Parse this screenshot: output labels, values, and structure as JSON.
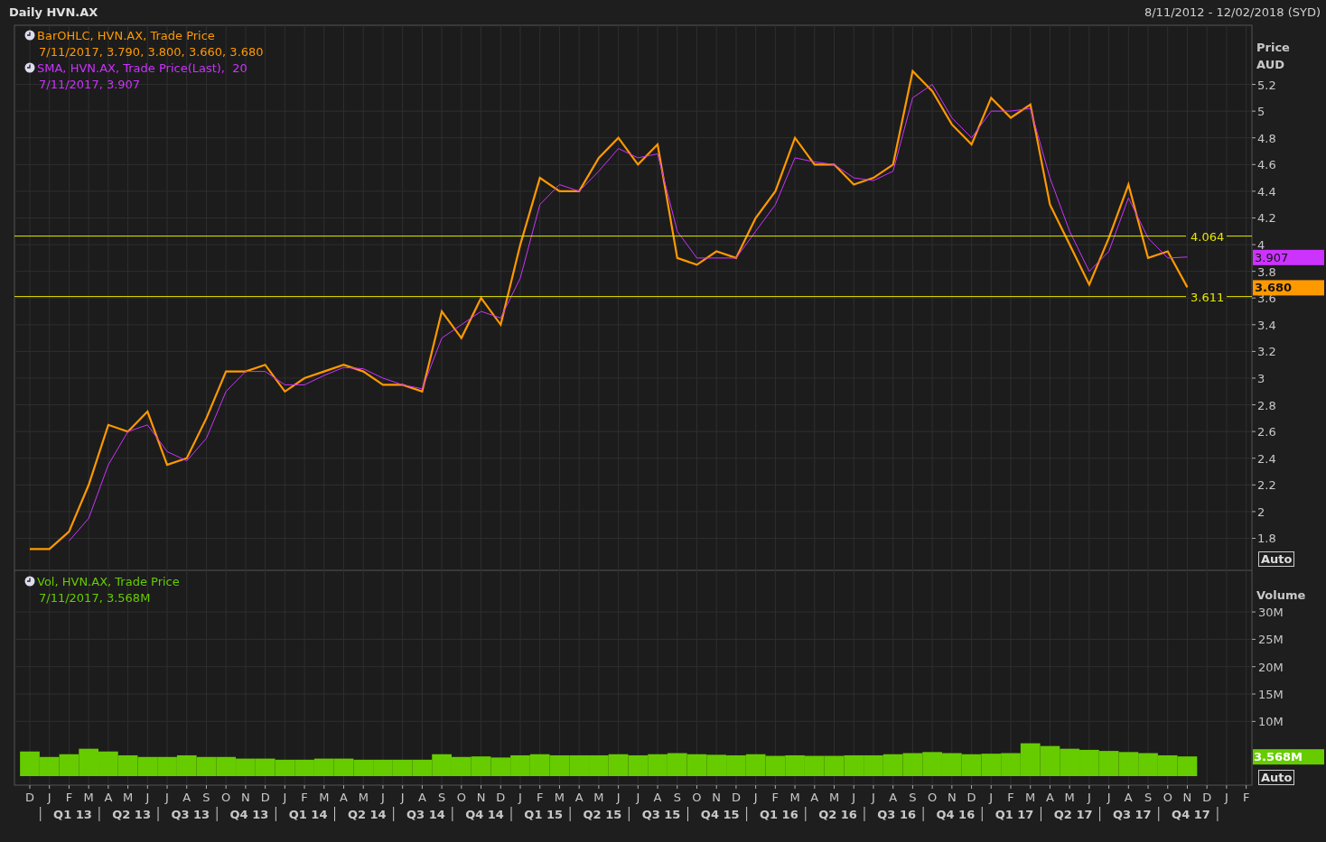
{
  "header": {
    "title": "Daily HVN.AX",
    "date_range": "8/11/2012 - 12/02/2018 (SYD)"
  },
  "price_panel": {
    "legend_readings": [
      "7/11/2017, 3.790, 3.800, 3.660, 3.680",
      "7/11/2017, 3.907"
    ],
    "axis_title": [
      "Price",
      "AUD"
    ],
    "last_value_tags": [
      "3.907",
      "3.680"
    ],
    "scale_button": "Auto",
    "chart_data": {
      "type": "line",
      "grid": true,
      "ylim": [
        1.56,
        5.65
      ],
      "yticks": [
        5.2,
        5,
        4.8,
        4.6,
        4.4,
        4.2,
        4,
        3.8,
        3.6,
        3.4,
        3.2,
        3,
        2.8,
        2.6,
        2.4,
        2.2,
        2,
        1.8
      ],
      "series": [
        {
          "name": "BarOHLC, HVN.AX, Trade Price",
          "color": "#ff9900",
          "values": [
            1.72,
            1.72,
            1.85,
            2.2,
            2.65,
            2.6,
            2.75,
            2.35,
            2.4,
            2.7,
            3.05,
            3.05,
            3.1,
            2.9,
            3.0,
            3.05,
            3.1,
            3.05,
            2.95,
            2.95,
            2.9,
            3.5,
            3.3,
            3.6,
            3.4,
            4.0,
            4.5,
            4.4,
            4.4,
            4.65,
            4.8,
            4.6,
            4.75,
            3.9,
            3.85,
            3.95,
            3.9,
            4.2,
            4.4,
            4.8,
            4.6,
            4.6,
            4.45,
            4.5,
            4.6,
            5.3,
            5.15,
            4.9,
            4.75,
            5.1,
            4.95,
            5.05,
            4.3,
            4.0,
            3.7,
            4.05,
            4.45,
            3.9,
            3.95,
            3.68
          ]
        },
        {
          "name": "SMA, HVN.AX, Trade Price(Last),  20",
          "color": "#cc33ff",
          "values": [
            null,
            null,
            1.78,
            1.95,
            2.35,
            2.6,
            2.65,
            2.45,
            2.38,
            2.55,
            2.9,
            3.05,
            3.05,
            2.95,
            2.95,
            3.02,
            3.08,
            3.07,
            3.0,
            2.95,
            2.92,
            3.3,
            3.4,
            3.5,
            3.45,
            3.75,
            4.3,
            4.45,
            4.4,
            4.55,
            4.72,
            4.65,
            4.68,
            4.1,
            3.9,
            3.9,
            3.9,
            4.1,
            4.3,
            4.65,
            4.62,
            4.6,
            4.5,
            4.48,
            4.55,
            5.1,
            5.2,
            4.95,
            4.8,
            5.0,
            5.0,
            5.02,
            4.5,
            4.1,
            3.8,
            3.95,
            4.35,
            4.05,
            3.9,
            3.907
          ]
        }
      ],
      "ref_lines": [
        {
          "axis": "y",
          "value": 4.064,
          "label": "4.064"
        },
        {
          "axis": "y",
          "value": 3.611,
          "label": "3.611"
        }
      ]
    }
  },
  "volume_panel": {
    "legend_readings": [
      "7/11/2017, 3.568M"
    ],
    "axis_title": [
      "Volume"
    ],
    "last_value_tags": [
      "3.568M"
    ],
    "scale_button": "Auto",
    "chart_data": {
      "type": "bar",
      "grid": true,
      "ylim": [
        0,
        37.6
      ],
      "categories": [
        "D",
        "J",
        "F",
        "M",
        "A",
        "M",
        "J",
        "J",
        "A",
        "S",
        "O",
        "N",
        "D",
        "J",
        "F",
        "M",
        "A",
        "M",
        "J",
        "J",
        "A",
        "S",
        "O",
        "N",
        "D",
        "J",
        "F",
        "M",
        "A",
        "M",
        "J",
        "J",
        "A",
        "S",
        "O",
        "N",
        "D",
        "J",
        "F",
        "M",
        "A",
        "M",
        "J",
        "J",
        "A",
        "S",
        "O",
        "N",
        "D",
        "J",
        "F",
        "M",
        "A",
        "M",
        "J",
        "J",
        "A",
        "S",
        "O",
        "N",
        "D",
        "J",
        "F"
      ],
      "yticks": [
        {
          "value": 30,
          "label": "30M"
        },
        {
          "value": 25,
          "label": "25M"
        },
        {
          "value": 20,
          "label": "20M"
        },
        {
          "value": 15,
          "label": "15M"
        },
        {
          "value": 10,
          "label": "10M"
        }
      ],
      "series": [
        {
          "name": "Vol, HVN.AX, Trade Price",
          "color": "#66cc00",
          "values": [
            4.5,
            3.5,
            4,
            5,
            4.5,
            3.8,
            3.5,
            3.5,
            3.8,
            3.5,
            3.5,
            3.2,
            3.2,
            3,
            3,
            3.2,
            3.2,
            3,
            3,
            3,
            3,
            4,
            3.5,
            3.6,
            3.4,
            3.8,
            4,
            3.8,
            3.8,
            3.8,
            4,
            3.8,
            4,
            4.2,
            4,
            3.9,
            3.8,
            4,
            3.7,
            3.8,
            3.7,
            3.7,
            3.8,
            3.8,
            4,
            4.2,
            4.4,
            4.2,
            4,
            4.1,
            4.2,
            6,
            5.5,
            5,
            4.8,
            4.6,
            4.4,
            4.2,
            3.8,
            3.6,
            null,
            null,
            null
          ]
        }
      ]
    }
  },
  "quarters": [
    "Q1 13",
    "Q2 13",
    "Q3 13",
    "Q4 13",
    "Q1 14",
    "Q2 14",
    "Q3 14",
    "Q4 14",
    "Q1 15",
    "Q2 15",
    "Q3 15",
    "Q4 15",
    "Q1 16",
    "Q2 16",
    "Q3 16",
    "Q4 16",
    "Q1 17",
    "Q2 17",
    "Q3 17",
    "Q4 17"
  ]
}
